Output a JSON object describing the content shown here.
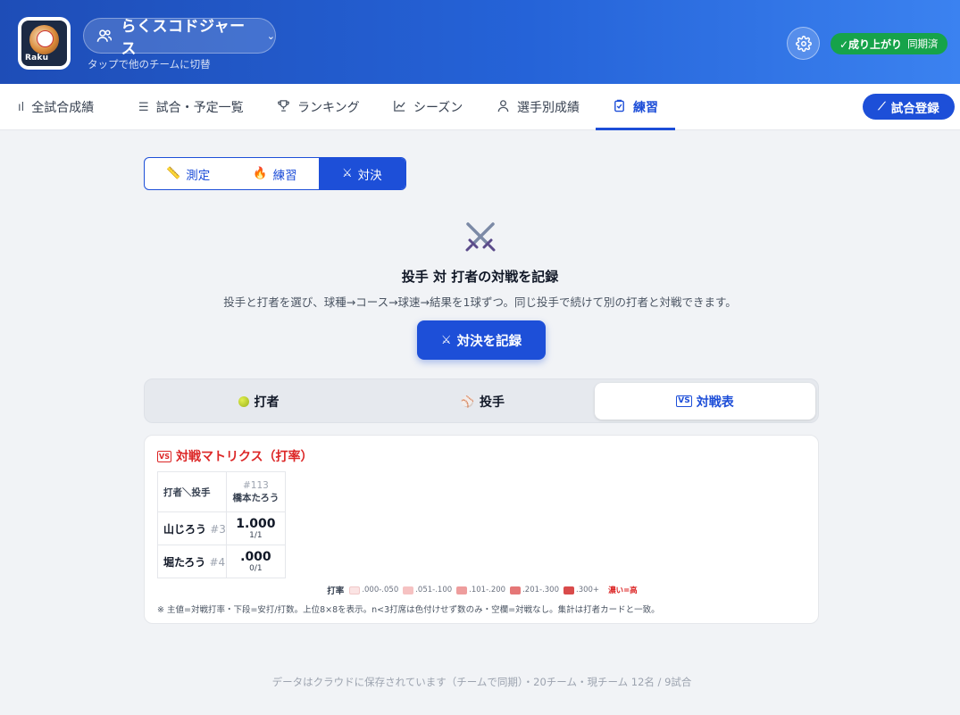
{
  "header": {
    "logo_text": "Raku",
    "team_name": "らくスコドジャース",
    "switch_hint": "タップで他のチームに切替",
    "sync_label": "✓成り上がり",
    "sync_status": "同期済"
  },
  "nav": {
    "tabs": [
      {
        "label": "全試合成績",
        "icon": "bar-chart-icon"
      },
      {
        "label": "試合・予定一覧",
        "icon": "list-icon"
      },
      {
        "label": "ランキング",
        "icon": "trophy-icon"
      },
      {
        "label": "シーズン",
        "icon": "line-chart-icon"
      },
      {
        "label": "選手別成績",
        "icon": "person-icon"
      },
      {
        "label": "練習",
        "icon": "clipboard-check-icon",
        "active": true
      }
    ],
    "register_button": "試合登録"
  },
  "segment": {
    "items": [
      {
        "label": "測定",
        "icon": "ruler-icon"
      },
      {
        "label": "練習",
        "icon": "fire-icon"
      },
      {
        "label": "対決",
        "icon": "crossed-swords-icon",
        "active": true
      }
    ]
  },
  "hero": {
    "title": "投手 対 打者の対戦を記録",
    "description": "投手と打者を選び、球種→コース→球速→結果を1球ずつ。同じ投手で続けて別の打者と対戦できます。",
    "button": "対決を記録"
  },
  "subtabs": {
    "items": [
      {
        "label": "打者",
        "icon": "ball-icon"
      },
      {
        "label": "投手",
        "icon": "baseball-icon"
      },
      {
        "label": "対戦表",
        "icon": "vs-icon",
        "active": true
      }
    ]
  },
  "matrix": {
    "title": "対戦マトリクス（打率）",
    "corner": "打者＼投手",
    "pitchers": [
      {
        "number": "#113",
        "name": "橋本たろう"
      }
    ],
    "batters": [
      {
        "name": "山じろう",
        "number": "#3",
        "cells": [
          {
            "avg": "1.000",
            "frac": "1/1"
          }
        ]
      },
      {
        "name": "堀たろう",
        "number": "#4",
        "cells": [
          {
            "avg": ".000",
            "frac": "0/1"
          }
        ]
      }
    ],
    "legend": {
      "title": "打率",
      "items": [
        {
          "label": ".000-.050",
          "color": "#fbe4e4"
        },
        {
          "label": ".051-.100",
          "color": "#f6c2c2"
        },
        {
          "label": ".101-.200",
          "color": "#ee9d9d"
        },
        {
          "label": ".201-.300",
          "color": "#e57777"
        },
        {
          "label": ".300+",
          "color": "#d94b4b"
        }
      ],
      "dark_label": "濃い=高"
    },
    "note": "※ 主値=対戦打率・下段=安打/打数。上位8×8を表示。n<3打席は色付けせず数のみ・空欄=対戦なし。集計は打者カードと一致。"
  },
  "footer": "データはクラウドに保存されています（チームで同期）・20チーム・現チーム 12名 / 9試合"
}
